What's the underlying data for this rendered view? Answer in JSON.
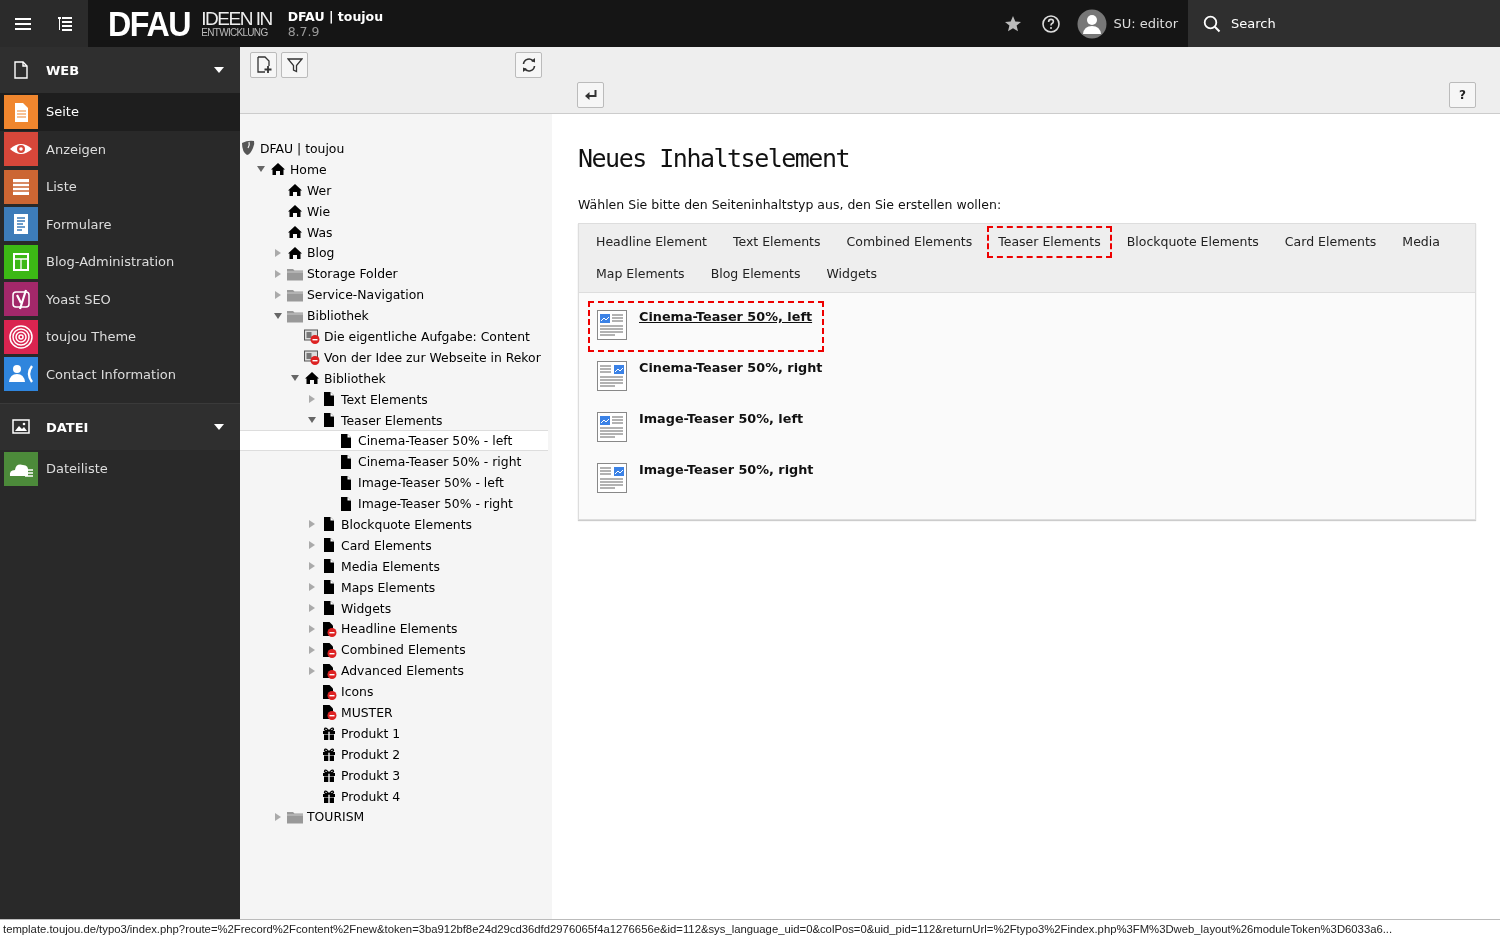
{
  "topbar": {
    "logo_main": "DFAU",
    "logo_line_1": "IDEEN IN",
    "logo_line_2": "ENTWICKLUNG",
    "site_name": "DFAU | toujou",
    "version": "8.7.9",
    "user": "SU: editor",
    "search": "Search"
  },
  "module_menu": {
    "groups": [
      {
        "label": "WEB",
        "kind": "page",
        "expanded": true,
        "modules": [
          {
            "label": "Seite",
            "kind": "page",
            "color": "#f0862e",
            "selected": true
          },
          {
            "label": "Anzeigen",
            "kind": "eye",
            "color": "#d7473a",
            "selected": false
          },
          {
            "label": "Liste",
            "kind": "list",
            "color": "#cc6633",
            "selected": false
          },
          {
            "label": "Formulare",
            "kind": "form",
            "color": "#3d7cb9",
            "selected": false
          },
          {
            "label": "Blog-Administration",
            "kind": "table",
            "color": "#3cb815",
            "selected": false
          },
          {
            "label": "Yoast SEO",
            "kind": "yoast",
            "color": "#a3286a",
            "selected": false
          },
          {
            "label": "toujou Theme",
            "kind": "fingerprint",
            "color": "#da2450",
            "selected": false
          },
          {
            "label": "Contact Information",
            "kind": "contact",
            "color": "#2f85dd",
            "selected": false
          }
        ]
      },
      {
        "label": "DATEI",
        "kind": "image",
        "expanded": true,
        "modules": [
          {
            "label": "Dateiliste",
            "kind": "cloud",
            "color": "#4c8a3a",
            "selected": false
          }
        ]
      }
    ]
  },
  "page_tree": {
    "nodes": [
      {
        "label": "DFAU | toujou",
        "kind": "site",
        "selected": false,
        "children": [
          {
            "label": "Home",
            "kind": "home",
            "selected": false,
            "expanded": true,
            "children": [
              {
                "label": "Wer",
                "kind": "home",
                "selected": false
              },
              {
                "label": "Wie",
                "kind": "home",
                "selected": false
              },
              {
                "label": "Was",
                "kind": "home",
                "selected": false
              },
              {
                "label": "Blog",
                "kind": "home",
                "selected": false,
                "expanded": false
              },
              {
                "label": "Storage Folder",
                "kind": "folder",
                "selected": false,
                "expanded": false
              },
              {
                "label": "Service-Navigation",
                "kind": "folder",
                "selected": false,
                "expanded": false
              },
              {
                "label": "Bibliothek",
                "kind": "folder",
                "selected": false,
                "expanded": true,
                "children": [
                  {
                    "label": "Die eigentliche Aufgabe: Content",
                    "kind": "content-hidden",
                    "selected": false
                  },
                  {
                    "label": "Von der Idee zur Webseite in Rekor",
                    "kind": "content-hidden",
                    "selected": false
                  },
                  {
                    "label": "Bibliothek",
                    "kind": "home",
                    "selected": false,
                    "expanded": true,
                    "children": [
                      {
                        "label": "Text Elements",
                        "kind": "page",
                        "selected": false,
                        "expanded": false
                      },
                      {
                        "label": "Teaser Elements",
                        "kind": "page",
                        "selected": false,
                        "expanded": true,
                        "children": [
                          {
                            "label": "Cinema-Teaser 50% - left",
                            "kind": "page",
                            "selected": true
                          },
                          {
                            "label": "Cinema-Teaser 50% - right",
                            "kind": "page",
                            "selected": false
                          },
                          {
                            "label": "Image-Teaser 50% - left",
                            "kind": "page",
                            "selected": false
                          },
                          {
                            "label": "Image-Teaser 50% - right",
                            "kind": "page",
                            "selected": false
                          }
                        ]
                      },
                      {
                        "label": "Blockquote Elements",
                        "kind": "page",
                        "selected": false,
                        "expanded": false
                      },
                      {
                        "label": "Card Elements",
                        "kind": "page",
                        "selected": false,
                        "expanded": false
                      },
                      {
                        "label": "Media Elements",
                        "kind": "page",
                        "selected": false,
                        "expanded": false
                      },
                      {
                        "label": "Maps Elements",
                        "kind": "page",
                        "selected": false,
                        "expanded": false
                      },
                      {
                        "label": "Widgets",
                        "kind": "page",
                        "selected": false,
                        "expanded": false
                      },
                      {
                        "label": "Headline Elements",
                        "kind": "page-hidden",
                        "selected": false,
                        "expanded": false
                      },
                      {
                        "label": "Combined Elements",
                        "kind": "page-hidden",
                        "selected": false,
                        "expanded": false
                      },
                      {
                        "label": "Advanced Elements",
                        "kind": "page-hidden",
                        "selected": false,
                        "expanded": false
                      },
                      {
                        "label": "Icons",
                        "kind": "page-hidden",
                        "selected": false
                      },
                      {
                        "label": "MUSTER",
                        "kind": "page-hidden",
                        "selected": false
                      },
                      {
                        "label": "Produkt 1",
                        "kind": "gift",
                        "selected": false
                      },
                      {
                        "label": "Produkt 2",
                        "kind": "gift",
                        "selected": false
                      },
                      {
                        "label": "Produkt 3",
                        "kind": "gift",
                        "selected": false
                      },
                      {
                        "label": "Produkt 4",
                        "kind": "gift",
                        "selected": false
                      }
                    ]
                  }
                ]
              },
              {
                "label": "TOURISM",
                "kind": "folder",
                "selected": false,
                "expanded": false
              }
            ]
          }
        ]
      }
    ]
  },
  "content": {
    "help_button": "?",
    "title": "Neues Inhaltselement",
    "intro": "Wählen Sie bitte den Seiteninhaltstyp aus, den Sie erstellen wollen:",
    "tabs": [
      {
        "label": "Headline Element",
        "selected": false
      },
      {
        "label": "Text Elements",
        "selected": false
      },
      {
        "label": "Combined Elements",
        "selected": false
      },
      {
        "label": "Teaser Elements",
        "selected": true
      },
      {
        "label": "Blockquote Elements",
        "selected": false
      },
      {
        "label": "Card Elements",
        "selected": false
      },
      {
        "label": "Media",
        "selected": false
      },
      {
        "label": "Map Elements",
        "selected": false
      },
      {
        "label": "Blog Elements",
        "selected": false
      },
      {
        "label": "Widgets",
        "selected": false
      }
    ],
    "items": [
      {
        "label": "Cinema-Teaser 50%, left",
        "kind": "image-left",
        "selected": true
      },
      {
        "label": "Cinema-Teaser 50%, right",
        "kind": "image-right",
        "selected": false
      },
      {
        "label": "Image-Teaser 50%, left",
        "kind": "image-left",
        "selected": false
      },
      {
        "label": "Image-Teaser 50%, right",
        "kind": "image-right",
        "selected": false
      }
    ]
  },
  "status_bar": {
    "url": "template.toujou.de/typo3/index.php?route=%2Frecord%2Fcontent%2Fnew&token=3ba912bf8e24d29cd36dfd2976065f4a1276656e&id=112&sys_language_uid=0&colPos=0&uid_pid=112&returnUrl=%2Ftypo3%2Findex.php%3FM%3Dweb_layout%26moduleToken%3D6033a6..."
  }
}
